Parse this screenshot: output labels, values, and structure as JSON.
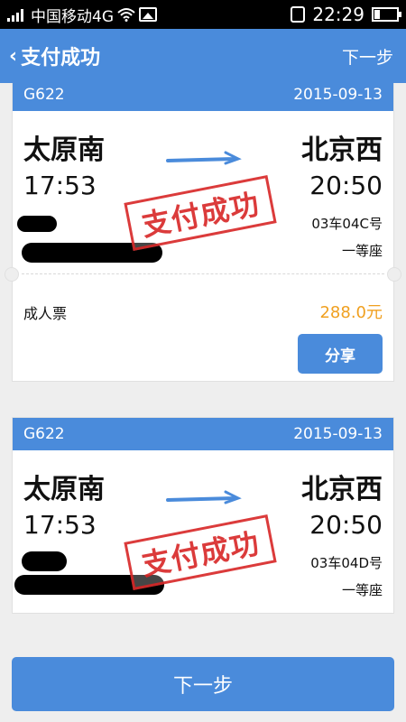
{
  "status_bar": {
    "carrier": "中国移动4G",
    "time": "22:29"
  },
  "nav": {
    "back_icon": "back-chevron-icon",
    "title": "支付成功",
    "next_label": "下一步"
  },
  "tickets": [
    {
      "train": "G622",
      "date": "2015-09-13",
      "from_station": "太原南",
      "to_station": "北京西",
      "depart_time": "17:53",
      "arrive_time": "20:50",
      "seat_no": "03车04C号",
      "seat_class": "一等座",
      "stamp": "支付成功",
      "ticket_type": "成人票",
      "price": "288.0元",
      "share_label": "分享"
    },
    {
      "train": "G622",
      "date": "2015-09-13",
      "from_station": "太原南",
      "to_station": "北京西",
      "depart_time": "17:53",
      "arrive_time": "20:50",
      "seat_no": "03车04D号",
      "seat_class": "一等座",
      "stamp": "支付成功"
    }
  ],
  "bottom": {
    "next_label": "下一步"
  },
  "colors": {
    "primary": "#4a8bdb",
    "price": "#f0a020",
    "stamp": "#d92b2b"
  }
}
